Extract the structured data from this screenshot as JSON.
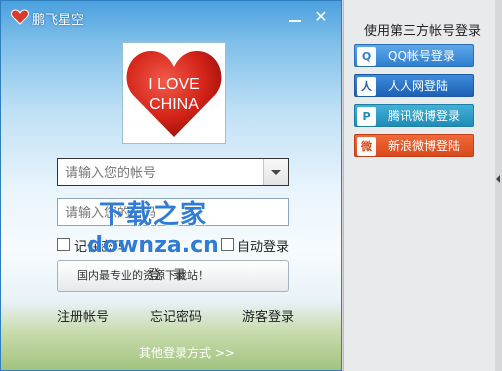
{
  "window": {
    "title": "鹏飞星空"
  },
  "avatar": {
    "line1": "I LOVE",
    "line2": "CHINA"
  },
  "login": {
    "account_placeholder": "请输入您的帐号",
    "password_placeholder": "请输入您的密码",
    "remember_label": "记住密码",
    "auto_login_label": "自动登录",
    "login_button": "登录",
    "register_link": "注册帐号",
    "forgot_link": "忘记密码",
    "guest_link": "游客登录",
    "other_login": "其他登录方式 >>"
  },
  "watermark": {
    "cn": "下载之家",
    "en": "downza.cn",
    "tagline": "国内最专业的资源下载站！"
  },
  "third_party": {
    "title": "使用第三方帐号登录",
    "buttons": [
      {
        "label": "QQ帐号登录",
        "icon": "qq-icon",
        "color": "#2f7fd0"
      },
      {
        "label": "人人网登陆",
        "icon": "renren-icon",
        "color": "#1d61b5"
      },
      {
        "label": "腾讯微博登录",
        "icon": "tencent-weibo-icon",
        "color": "#1f8cb8"
      },
      {
        "label": "新浪微博登陆",
        "icon": "sina-weibo-icon",
        "color": "#d9491b"
      }
    ]
  }
}
